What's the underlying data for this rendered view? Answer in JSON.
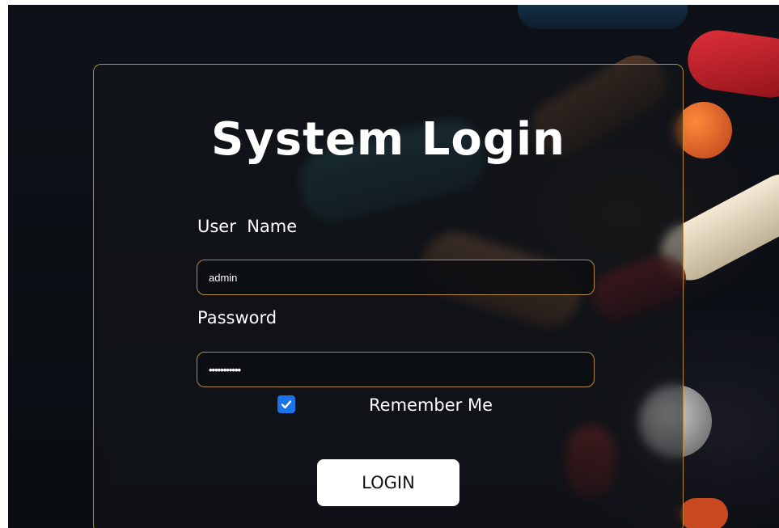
{
  "login": {
    "title": "System Login",
    "username_label": "User  Name",
    "username_value": "admin",
    "password_label": "Password",
    "password_value": "•••••••••••",
    "remember_label": "Remember Me",
    "remember_checked": true,
    "login_button": "LOGIN"
  },
  "colors": {
    "accent_border": "#b58a3c",
    "checkbox": "#1a73e8",
    "background": "#0c0f14"
  }
}
